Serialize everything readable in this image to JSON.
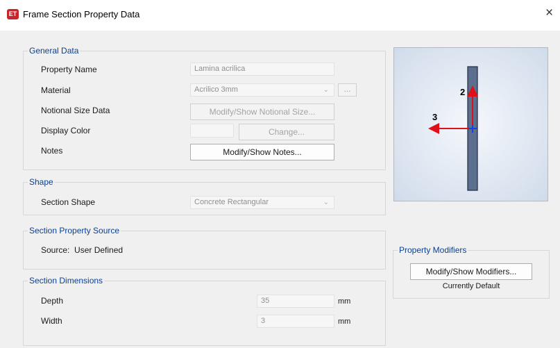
{
  "window": {
    "title": "Frame Section Property Data",
    "icon_text": "ET",
    "close_glyph": "×"
  },
  "general_data": {
    "legend": "General Data",
    "property_name": {
      "label": "Property Name",
      "value": "Lamina acrilica"
    },
    "material": {
      "label": "Material",
      "value": "Acrilico 3mm",
      "dots": "..."
    },
    "notional_size": {
      "label": "Notional Size Data",
      "button": "Modify/Show Notional Size..."
    },
    "display_color": {
      "label": "Display Color",
      "button": "Change..."
    },
    "notes": {
      "label": "Notes",
      "button": "Modify/Show Notes..."
    }
  },
  "shape": {
    "legend": "Shape",
    "section_shape": {
      "label": "Section Shape",
      "value": "Concrete Rectangular"
    }
  },
  "section_property_source": {
    "legend": "Section Property Source",
    "source": "Source:  User Defined"
  },
  "section_dimensions": {
    "legend": "Section Dimensions",
    "depth": {
      "label": "Depth",
      "value": "35",
      "unit": "mm"
    },
    "width": {
      "label": "Width",
      "value": "3",
      "unit": "mm"
    }
  },
  "preview": {
    "axis_2": "2",
    "axis_3": "3"
  },
  "property_modifiers": {
    "legend": "Property Modifiers",
    "button": "Modify/Show Modifiers...",
    "status": "Currently Default"
  },
  "colors": {
    "accent": "#0b3f8f",
    "arrow": "#e0101b",
    "centroid": "#1f3fd6",
    "section_fill": "#5c6f8e"
  }
}
